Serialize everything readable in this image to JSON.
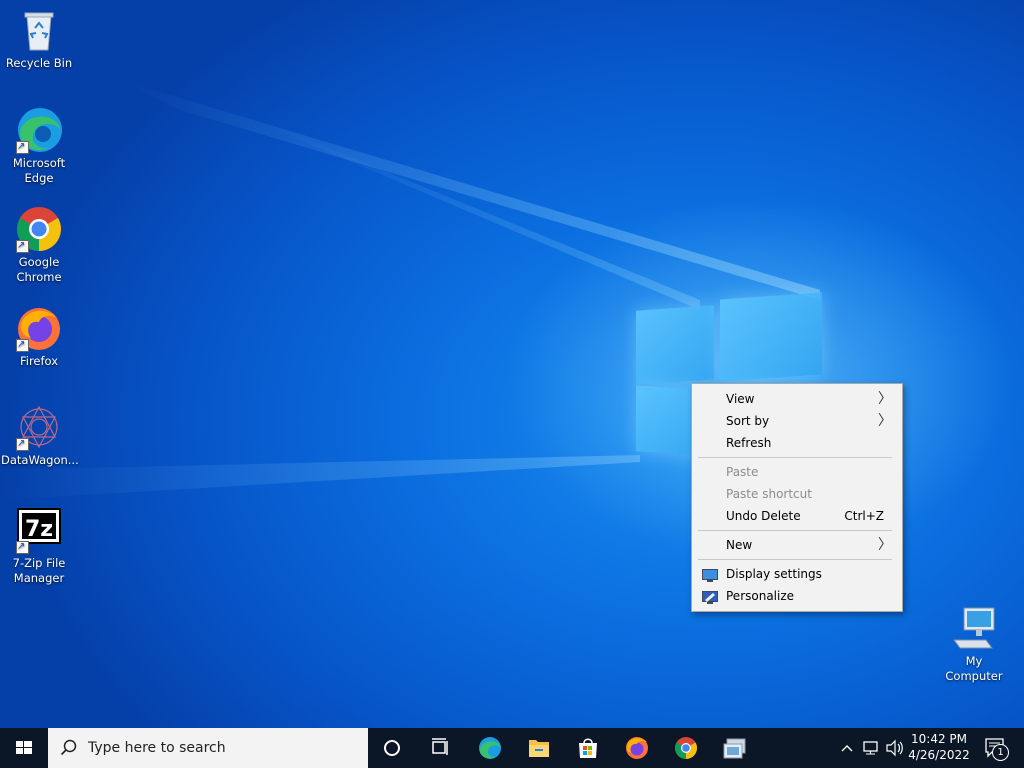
{
  "desktop": {
    "icons": [
      {
        "label": "Recycle Bin",
        "icon": "recycle-bin-icon"
      },
      {
        "label": "Microsoft Edge",
        "icon": "edge-icon"
      },
      {
        "label": "Google Chrome",
        "icon": "chrome-icon"
      },
      {
        "label": "Firefox",
        "icon": "firefox-icon"
      },
      {
        "label": "DataWagon...",
        "icon": "datawagon-icon"
      },
      {
        "label": "7-Zip File Manager",
        "icon": "7zip-icon"
      },
      {
        "label": "My Computer",
        "icon": "computer-icon"
      }
    ]
  },
  "context_menu": {
    "items": [
      {
        "label": "View",
        "submenu": true
      },
      {
        "label": "Sort by",
        "submenu": true
      },
      {
        "label": "Refresh"
      },
      {
        "label": "Paste",
        "disabled": true
      },
      {
        "label": "Paste shortcut",
        "disabled": true
      },
      {
        "label": "Undo Delete",
        "shortcut": "Ctrl+Z"
      },
      {
        "label": "New",
        "submenu": true
      },
      {
        "label": "Display settings",
        "icon": "display-icon"
      },
      {
        "label": "Personalize",
        "icon": "personalize-icon"
      }
    ]
  },
  "taskbar": {
    "search_placeholder": "Type here to search",
    "pinned": [
      "cortana-icon",
      "task-view-icon",
      "edge-icon",
      "file-explorer-icon",
      "store-icon",
      "firefox-icon",
      "chrome-icon",
      "network-app-icon"
    ],
    "clock": {
      "time": "10:42 PM",
      "date": "4/26/2022"
    },
    "notification_count": "1"
  },
  "colors": {
    "accent": "#0b6fe0",
    "taskbar": "#0b1626",
    "menu_bg": "#f2f2f2"
  }
}
